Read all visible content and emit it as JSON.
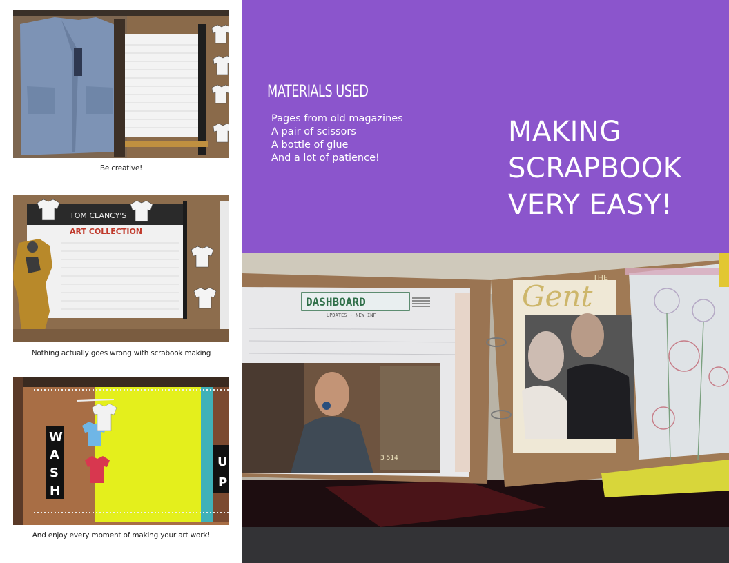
{
  "left_column": {
    "photos": [
      {
        "caption": "Be creative!"
      },
      {
        "caption": "Nothing actually goes wrong with scrabook making",
        "sign_line1": "TOM CLANCY'S",
        "sign_line2": "ART COLLECTION"
      },
      {
        "caption": "And enjoy every moment of making your art work!",
        "wash_letters": [
          "W",
          "A",
          "S",
          "H"
        ],
        "up_letters": [
          "U",
          "P"
        ]
      }
    ]
  },
  "banner": {
    "materials_heading": "MATERIALS USED",
    "materials": [
      "Pages from old magazines",
      "A pair of scissors",
      "A bottle of glue",
      "And a lot of patience!"
    ],
    "title_lines": [
      "MAKING",
      "SCRAPBOOK",
      "VERY EASY!"
    ],
    "colors": {
      "panel": "#8b55cc",
      "footer": "#333336",
      "text": "#ffffff"
    }
  },
  "feature_photo": {
    "sticker_dashboard": "DASHBOARD",
    "sticker_updates": "UPDATES - NEW INF",
    "photo_number": "3 514",
    "magazine_the": "THE",
    "magazine_gent": "Gent"
  }
}
